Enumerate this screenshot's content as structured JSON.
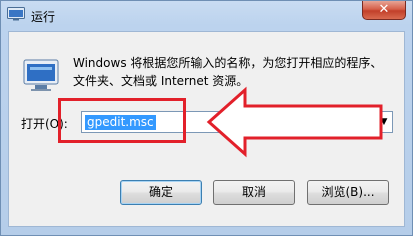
{
  "window": {
    "title": "运行",
    "close_glyph": "✕",
    "title_icon": "run-app-icon"
  },
  "dialog": {
    "description_line1": "Windows 将根据您所输入的名称，为您打开相应的程序、",
    "description_line2": "文件夹、文档或 Internet 资源。",
    "run_icon": "run-program-icon",
    "open_label": "打开(O):",
    "open_value": "gpedit.msc",
    "dropdown_glyph": "▼"
  },
  "annotation": {
    "highlight_color": "#e2202a",
    "arrow": "left-arrow-pointer"
  },
  "buttons": {
    "ok": "确定",
    "cancel": "取消",
    "browse": "浏览(B)..."
  }
}
